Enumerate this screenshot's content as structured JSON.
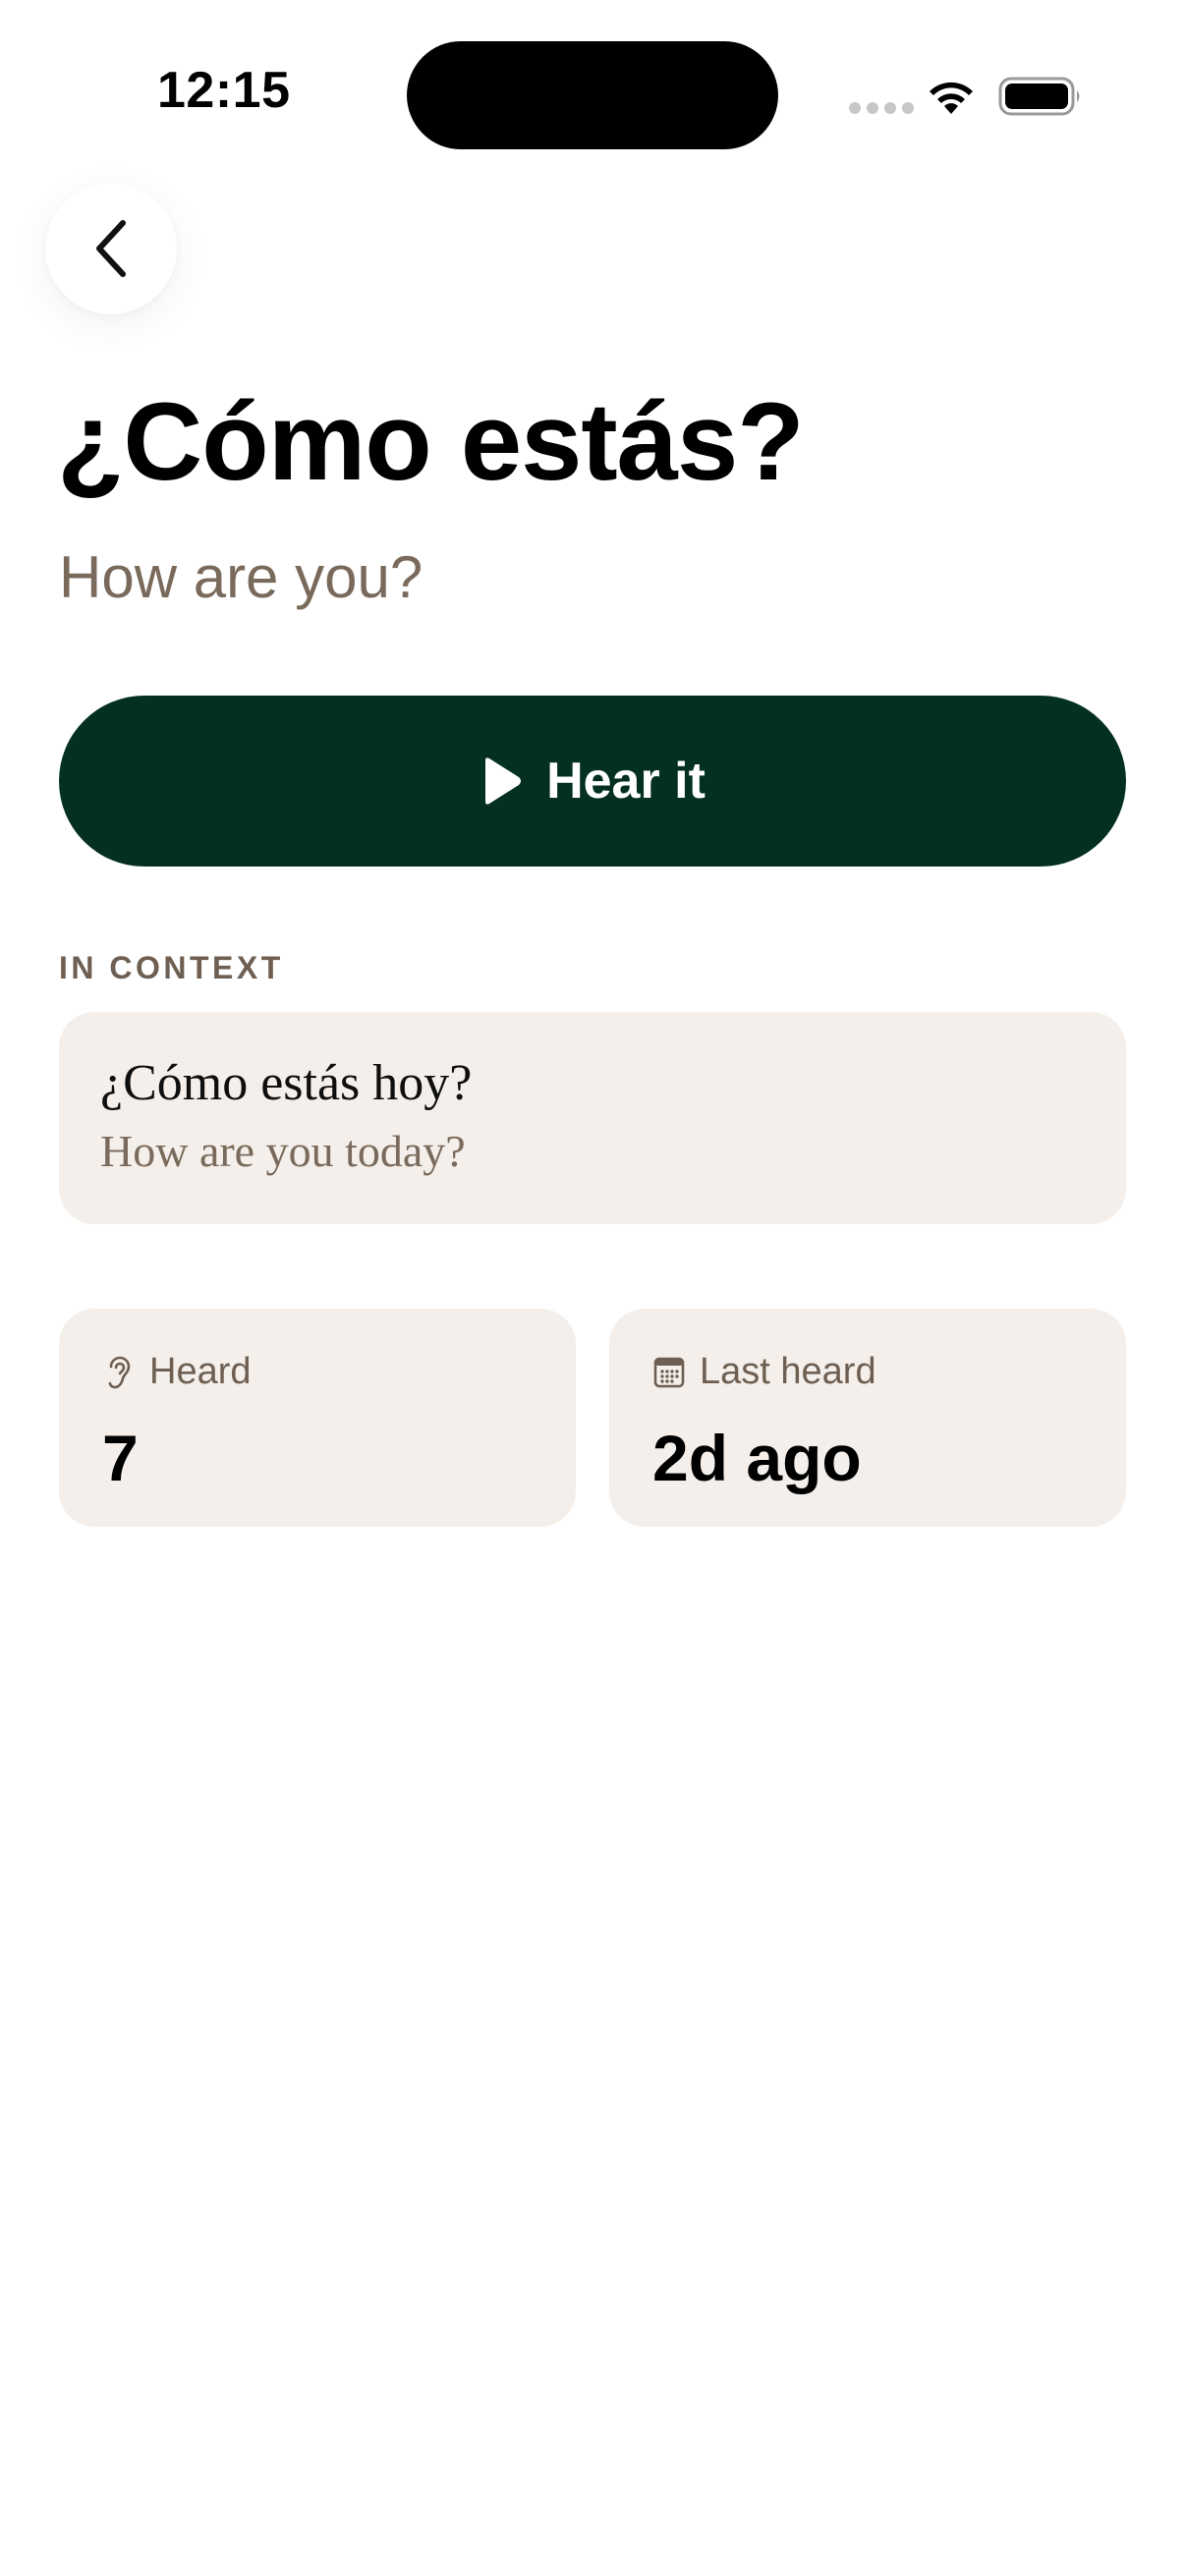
{
  "status_bar": {
    "time": "12:15",
    "icons": [
      "signal-dots-icon",
      "wifi-icon",
      "battery-icon"
    ]
  },
  "header": {
    "back_icon": "chevron-left-icon"
  },
  "phrase": {
    "text": "¿Cómo estás?",
    "translation": "How are you?"
  },
  "hear_button": {
    "label": "Hear it",
    "icon": "play-icon"
  },
  "context": {
    "section_label": "IN CONTEXT",
    "sentence": "¿Cómo estás hoy?",
    "translation": "How are you today?"
  },
  "stats": {
    "heard": {
      "icon": "ear-icon",
      "label": "Heard",
      "value": "7"
    },
    "last_heard": {
      "icon": "calendar-icon",
      "label": "Last heard",
      "value": "2d ago"
    }
  },
  "colors": {
    "primary": "#033022",
    "card_bg": "#f4efea",
    "muted_text": "#7a6a5c",
    "label_text": "#6e5f52"
  }
}
